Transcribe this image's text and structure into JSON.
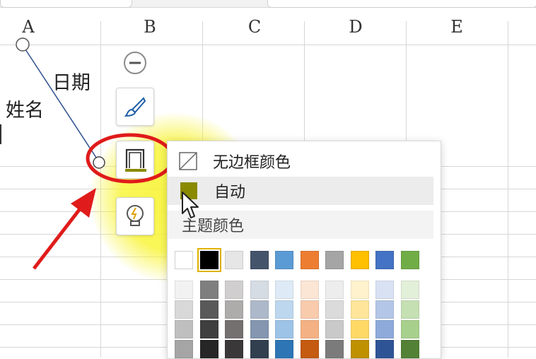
{
  "columns": [
    "A",
    "B",
    "C",
    "D",
    "E"
  ],
  "cells": {
    "diag_top_label": "日期",
    "diag_bottom_label": "姓名"
  },
  "toolbar": {
    "minus_icon": "minus-circle-icon",
    "brush_icon": "brush-icon",
    "border_icon": "border-color-icon",
    "bulb_icon": "lightbulb-icon"
  },
  "menu": {
    "no_border_label": "无边框颜色",
    "auto_label": "自动",
    "theme_label": "主题颜色",
    "auto_color": "#8a8a00"
  },
  "theme_colors": {
    "base": [
      "#ffffff",
      "#000000",
      "#e7e6e6",
      "#44546a",
      "#5b9bd5",
      "#ed7d31",
      "#a5a5a5",
      "#ffc000",
      "#4472c4",
      "#70ad47"
    ],
    "shades": [
      [
        "#f2f2f2",
        "#7f7f7f",
        "#d0cece",
        "#d6dce4",
        "#deebf6",
        "#fbe5d5",
        "#ededed",
        "#fff2cc",
        "#d9e2f3",
        "#e2efd9"
      ],
      [
        "#d8d8d8",
        "#595959",
        "#aeabab",
        "#adb9ca",
        "#bdd7ee",
        "#f8cbad",
        "#dbdbdb",
        "#fee599",
        "#b4c6e7",
        "#c5e0b3"
      ],
      [
        "#bfbfbf",
        "#3f3f3f",
        "#757070",
        "#8496b0",
        "#9dc3e6",
        "#f4b183",
        "#c9c9c9",
        "#ffd965",
        "#8eaadb",
        "#a8d08d"
      ],
      [
        "#a5a5a5",
        "#262626",
        "#3a3838",
        "#323f4f",
        "#2e75b5",
        "#c55a11",
        "#7b7b7b",
        "#bf9000",
        "#2f5496",
        "#538135"
      ]
    ]
  }
}
